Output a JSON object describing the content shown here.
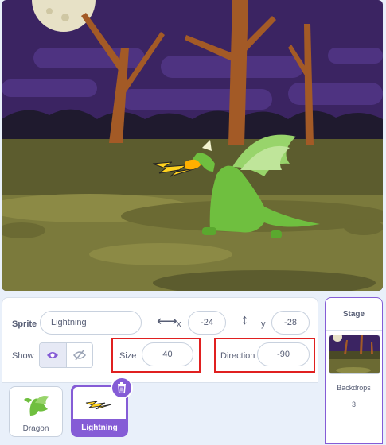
{
  "sprite_info": {
    "sprite_label": "Sprite",
    "sprite_name": "Lightning",
    "x_label": "x",
    "x_value": "-24",
    "y_label": "y",
    "y_value": "-28",
    "show_label": "Show",
    "size_label": "Size",
    "size_value": "40",
    "direction_label": "Direction",
    "direction_value": "-90"
  },
  "sprites": [
    {
      "name": "Dragon",
      "selected": false
    },
    {
      "name": "Lightning",
      "selected": true
    }
  ],
  "stage_panel": {
    "title": "Stage",
    "backdrops_label": "Backdrops",
    "backdrops_count": "3"
  },
  "colors": {
    "accent": "#855cd6",
    "highlight_box": "#e02020",
    "text": "#575e75"
  },
  "icons": [
    "eye-icon",
    "eye-slash-icon",
    "horizontal-arrows-icon",
    "vertical-arrows-icon",
    "trash-icon"
  ]
}
